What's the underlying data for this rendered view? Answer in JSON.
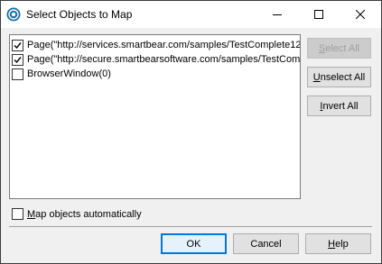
{
  "window": {
    "title": "Select Objects to Map",
    "minimize_icon": "minimize-icon",
    "maximize_icon": "maximize-icon",
    "close_icon": "close-icon"
  },
  "objects": {
    "items": [
      {
        "label": "Page(\"http://services.smartbear.com/samples/TestComplete12",
        "checked": true
      },
      {
        "label": "Page(\"http://secure.smartbearsoftware.com/samples/TestCom",
        "checked": true
      },
      {
        "label": "BrowserWindow(0)",
        "checked": false
      }
    ]
  },
  "side_buttons": {
    "select_all": {
      "mnemonic": "S",
      "rest": "elect All",
      "enabled": false
    },
    "unselect_all": {
      "mnemonic": "U",
      "rest": "nselect All",
      "enabled": true
    },
    "invert_all": {
      "mnemonic": "I",
      "rest": "nvert All",
      "enabled": true
    }
  },
  "auto_map": {
    "mnemonic": "M",
    "rest": "ap objects automatically",
    "checked": false
  },
  "footer": {
    "ok": "OK",
    "cancel": "Cancel",
    "help_mnemonic": "H",
    "help_rest": "elp"
  },
  "colors": {
    "accent": "#0078d7",
    "icon": "#1a6fa8"
  }
}
